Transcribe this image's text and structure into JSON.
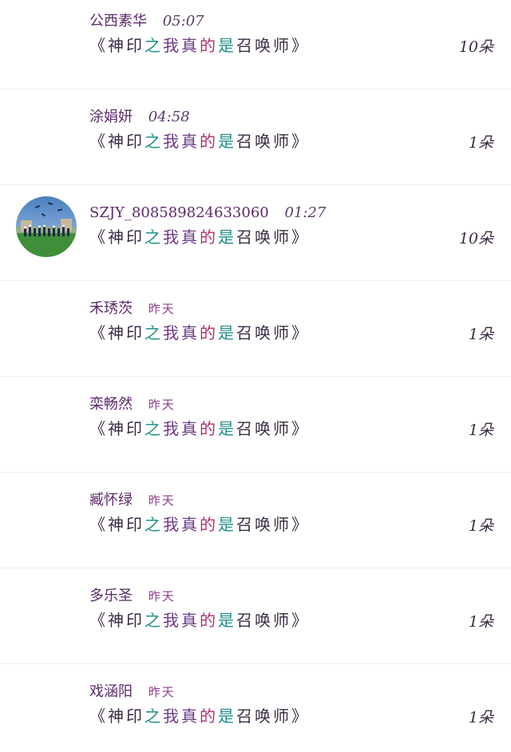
{
  "title_prefix": "《神印",
  "title_mid1": "之",
  "title_mid2": "我真",
  "title_mid3": "的",
  "title_mid4": "是",
  "title_suffix": "召唤师》",
  "rows": [
    {
      "name": "公西素华",
      "time": "05:07",
      "count": "10朵"
    },
    {
      "name": "涂娟妍",
      "time": "04:58",
      "count": "1朵"
    },
    {
      "name": "SZJY_808589824633060",
      "time": "01:27",
      "count": "10朵"
    },
    {
      "name": "禾琇茨",
      "time": "昨天",
      "count": "1朵"
    },
    {
      "name": "栾畅然",
      "time": "昨天",
      "count": "1朵"
    },
    {
      "name": "臧怀绿",
      "time": "昨天",
      "count": "1朵"
    },
    {
      "name": "多乐圣",
      "time": "昨天",
      "count": "1朵"
    },
    {
      "name": "戏涵阳",
      "time": "昨天",
      "count": "1朵"
    }
  ]
}
